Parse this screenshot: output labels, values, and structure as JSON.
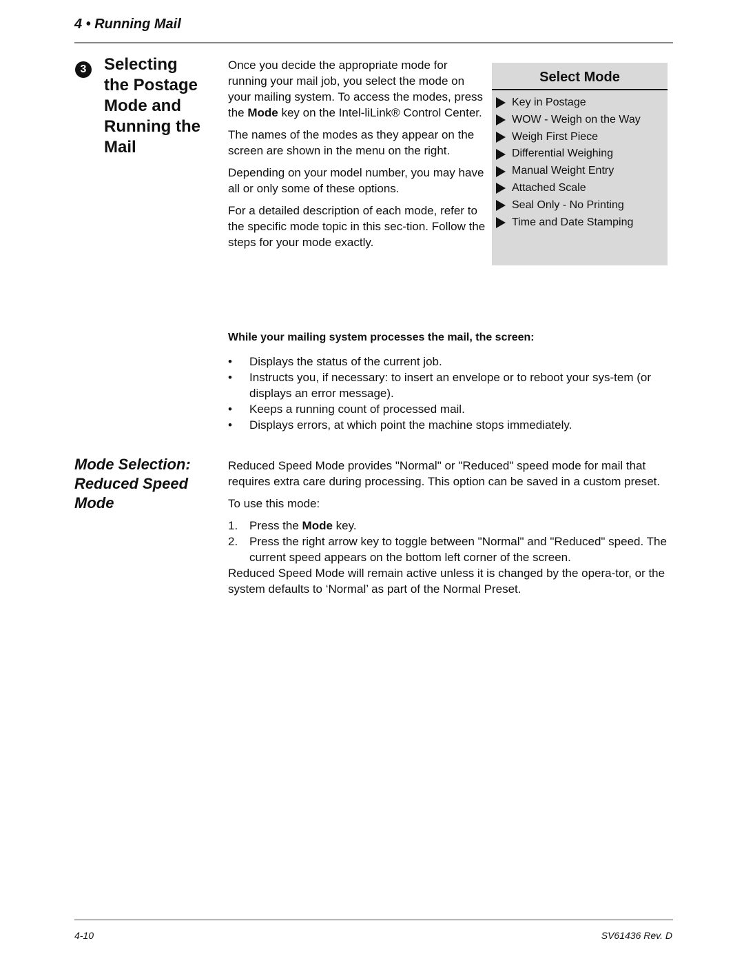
{
  "header": {
    "chapter": "4 • Running Mail"
  },
  "section": {
    "step_number": "3",
    "title_lines": [
      "Selecting",
      "the Postage",
      "Mode and",
      "Running the",
      "Mail"
    ],
    "paragraphs": {
      "p1_before": "Once you decide the appropriate mode for running your mail job, you select the mode on your mailing system. To access the modes, press the ",
      "p1_bold": "Mode",
      "p1_after": " key on the Intel-liLink® Control Center.",
      "p2": "The names of the modes as they appear on the screen are shown in the menu on the right.",
      "p3": "Depending on your model number, you may have all or only some of these options.",
      "p4": "For a detailed description of each mode, refer to the specific mode topic in this sec-tion. Follow the steps for your mode exactly."
    }
  },
  "select_mode_menu": {
    "title": "Select Mode",
    "items": [
      "Key in Postage",
      "WOW - Weigh on the Way",
      "Weigh First Piece",
      "Differential Weighing",
      "Manual Weight Entry",
      "Attached Scale",
      "Seal Only - No Printing",
      "Time and Date Stamping"
    ]
  },
  "processing": {
    "heading": "While your mailing system processes the mail, the screen:",
    "bullet_char": "•",
    "bullets": [
      "Displays the status of the current job.",
      "Instructs you, if necessary:  to insert an envelope or to reboot your sys-tem (or displays an error message).",
      "Keeps a running count of processed mail.",
      "Displays errors, at which point the machine stops immediately."
    ]
  },
  "reduced_speed": {
    "title_lines": [
      "Mode Selection:",
      "Reduced Speed",
      "Mode"
    ],
    "intro": "Reduced Speed Mode provides \"Normal\" or \"Reduced\" speed mode for mail that requires extra care during processing. This option can be saved in a custom preset.",
    "to_use": "To use this mode:",
    "steps": [
      {
        "num": "1.",
        "before": "Press the ",
        "bold": "Mode",
        "after": " key."
      },
      {
        "num": "2.",
        "before": "Press the right arrow key to toggle between \"Normal\" and \"Reduced\" speed. The current speed appears on the bottom left corner of the screen.",
        "bold": "",
        "after": ""
      }
    ],
    "closing": "Reduced Speed Mode will remain active unless it is changed by the opera-tor, or the system defaults to ‘Normal’ as part of the Normal Preset."
  },
  "footer": {
    "page_number": "4-10",
    "doc_id": "SV61436 Rev. D"
  }
}
